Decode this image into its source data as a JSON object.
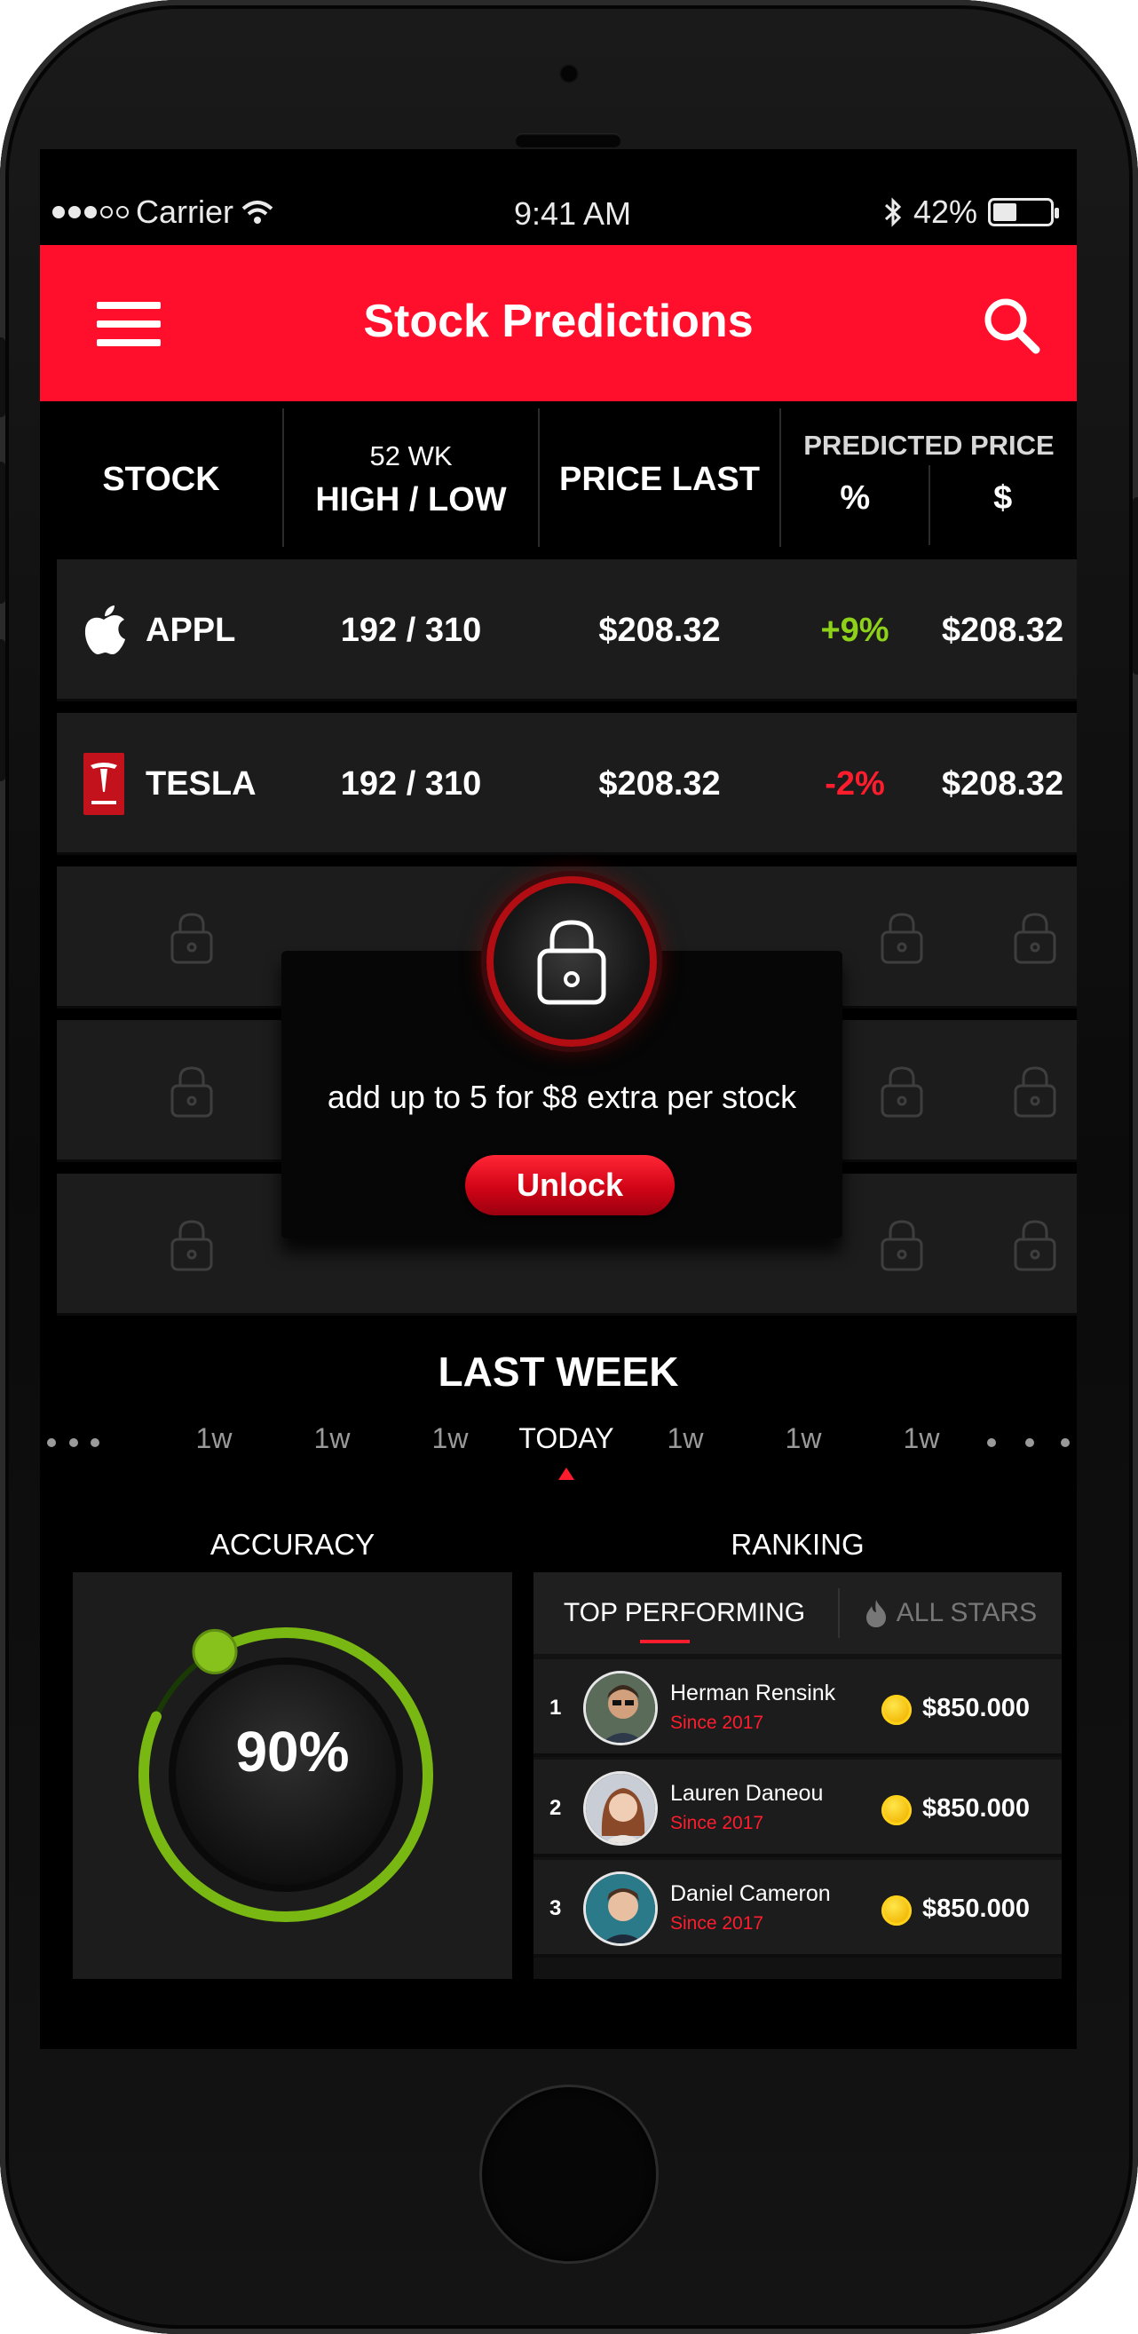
{
  "status_bar": {
    "carrier": "Carrier",
    "time": "9:41 AM",
    "battery": "42%",
    "battery_level": 0.42
  },
  "header": {
    "title": "Stock Predictions",
    "menu_icon": "hamburger-menu-icon",
    "search_icon": "search-icon"
  },
  "table": {
    "columns": {
      "stock": "STOCK",
      "hl_top": "52 WK",
      "hl_bottom": "HIGH / LOW",
      "price_last": "PRICE LAST",
      "predicted": "PREDICTED PRICE",
      "pct": "%",
      "dollar": "$"
    },
    "rows": [
      {
        "name": "APPL",
        "logo": "apple-logo-icon",
        "high_low": "192 / 310",
        "price_last": "$208.32",
        "pct": "+9%",
        "predicted": "$208.32"
      },
      {
        "name": "TESLA",
        "logo": "tesla-logo-icon",
        "high_low": "192 / 310",
        "price_last": "$208.32",
        "pct": "-2%",
        "predicted": "$208.32"
      }
    ],
    "locked_rows": 3
  },
  "unlock_popup": {
    "message": "add up to 5 for $8 extra per stock",
    "button": "Unlock",
    "icon": "lock-icon"
  },
  "last_week": {
    "title": "LAST WEEK",
    "timeline": [
      "1w",
      "1w",
      "1w",
      "TODAY",
      "1w",
      "1w",
      "1w"
    ],
    "active_index": 3
  },
  "accuracy": {
    "label": "ACCURACY",
    "value": "90%",
    "fraction": 0.9
  },
  "ranking": {
    "label": "RANKING",
    "tabs": [
      "TOP PERFORMING",
      "ALL STARS"
    ],
    "tab_icon": "flame-icon",
    "entries": [
      {
        "rank": "1",
        "name": "Herman Rensink",
        "since": "Since 2017",
        "amount": "$850.000"
      },
      {
        "rank": "2",
        "name": "Lauren Daneou",
        "since": "Since 2017",
        "amount": "$850.000"
      },
      {
        "rank": "3",
        "name": "Daniel Cameron",
        "since": "Since 2017",
        "amount": "$850.000"
      }
    ]
  },
  "colors": {
    "accent_red": "#ff0f2c",
    "positive_green": "#8ed11a",
    "negative_red": "#ff1d2d",
    "row_bg": "#1c1c1c"
  }
}
